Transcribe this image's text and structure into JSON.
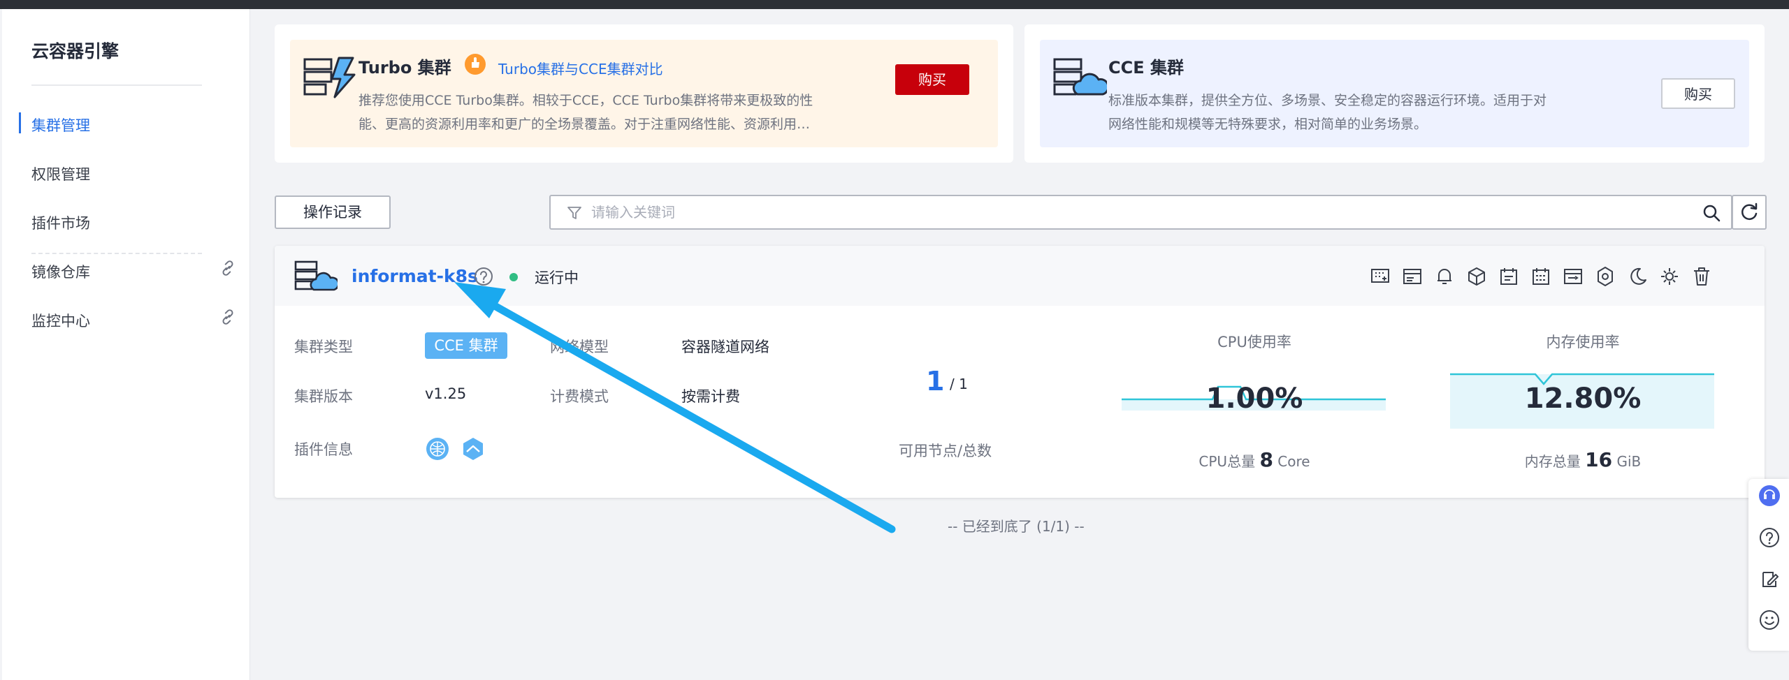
{
  "sidebar": {
    "title": "云容器引擎",
    "items": [
      {
        "label": "集群管理",
        "active": true
      },
      {
        "label": "权限管理"
      },
      {
        "label": "插件市场"
      },
      {
        "label": "镜像仓库",
        "external": true
      },
      {
        "label": "监控中心",
        "external": true
      }
    ]
  },
  "promo_turbo": {
    "title": "Turbo 集群",
    "compare_link": "Turbo集群与CCE集群对比",
    "desc_line1": "推荐您使用CCE Turbo集群。相较于CCE，CCE Turbo集群将带来更极致的性",
    "desc_line2": "能、更高的资源利用率和更广的全场景覆盖。对于注重网络性能、资源利用…",
    "buy_label": "购买"
  },
  "promo_cce": {
    "title": "CCE 集群",
    "desc_line1": "标准版本集群，提供全方位、多场景、安全稳定的容器运行环境。适用于对",
    "desc_line2": "网络性能和规模等无特殊要求，相对简单的业务场景。",
    "buy_label": "购买"
  },
  "toolbar": {
    "op_record_label": "操作记录",
    "search_placeholder": "请输入关键词"
  },
  "cluster": {
    "name": "informat-k8s",
    "status": "运行中",
    "status_color": "#31bd83",
    "type_label": "集群类型",
    "type_value": "CCE 集群",
    "network_label": "网络模型",
    "network_value": "容器隧道网络",
    "version_label": "集群版本",
    "version_value": "v1.25",
    "billing_label": "计费模式",
    "billing_value": "按需计费",
    "plugin_label": "插件信息",
    "nodes_available": "1",
    "nodes_total": "/ 1",
    "nodes_label": "可用节点/总数",
    "cpu": {
      "title": "CPU使用率",
      "value": "1.00%",
      "total_prefix": "CPU总量",
      "total_num": "8",
      "total_unit": "Core"
    },
    "mem": {
      "title": "内存使用率",
      "value": "12.80%",
      "total_prefix": "内存总量",
      "total_num": "16",
      "total_unit": "GiB"
    },
    "action_icons": [
      "grid-add-icon",
      "list-icon",
      "bell-icon",
      "cube-icon",
      "calendar-icon",
      "schedule-icon",
      "console-icon",
      "settings-icon",
      "moon-icon",
      "gear-cluster-icon",
      "delete-icon"
    ]
  },
  "list_end": "-- 已经到底了 (1/1) --",
  "colors": {
    "primary": "#2770e6",
    "buy_red": "#c7000b",
    "badge_blue": "#5bb2f4",
    "annotation_arrow": "#1aa9ef"
  }
}
